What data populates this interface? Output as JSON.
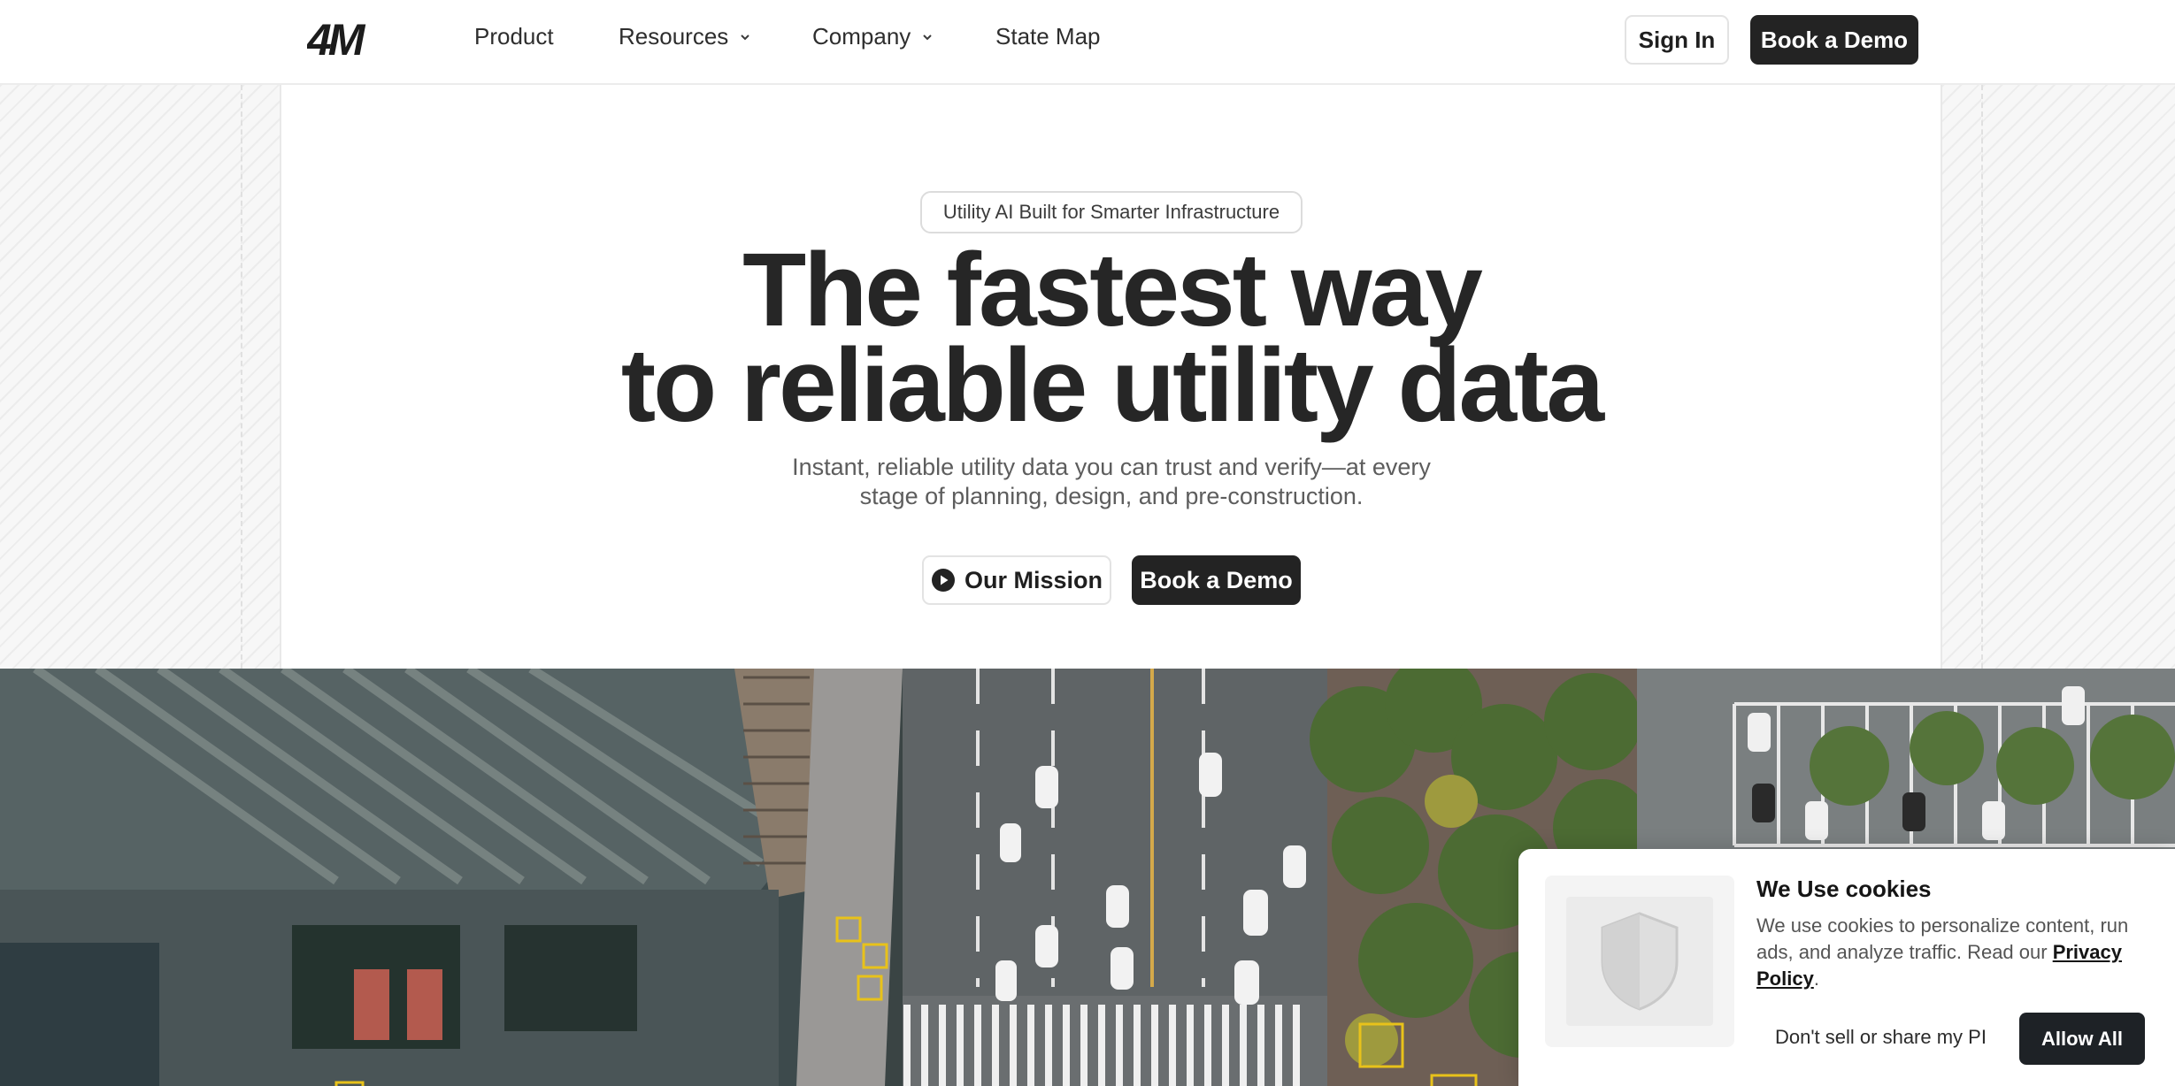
{
  "nav": {
    "logo_text": "4M",
    "items": [
      {
        "label": "Product"
      },
      {
        "label": "Resources"
      },
      {
        "label": "Company"
      },
      {
        "label": "State Map"
      }
    ],
    "sign_in": "Sign In",
    "book_demo": "Book a Demo"
  },
  "hero": {
    "badge": "Utility AI Built for Smarter Infrastructure",
    "headline_line1": "The fastest way",
    "headline_line2": "to reliable utility data",
    "subheadline": "Instant, reliable utility data you can trust and verify—at every stage of planning, design, and pre-construction.",
    "mission_button": "Our Mission",
    "demo_button": "Book a Demo"
  },
  "cookie_banner": {
    "title": "We Use cookies",
    "body": "We use cookies to personalize content, run ads, and analyze traffic. Read our ",
    "policy_link": "Privacy Policy",
    "body_end": ".",
    "dont_sell": "Don't sell or share my PI",
    "allow_all": "Allow All"
  },
  "colors": {
    "dark_button": "#232323",
    "accent_box": "#e8c21a",
    "text_primary": "#262626",
    "text_muted": "#5d5d5d"
  }
}
